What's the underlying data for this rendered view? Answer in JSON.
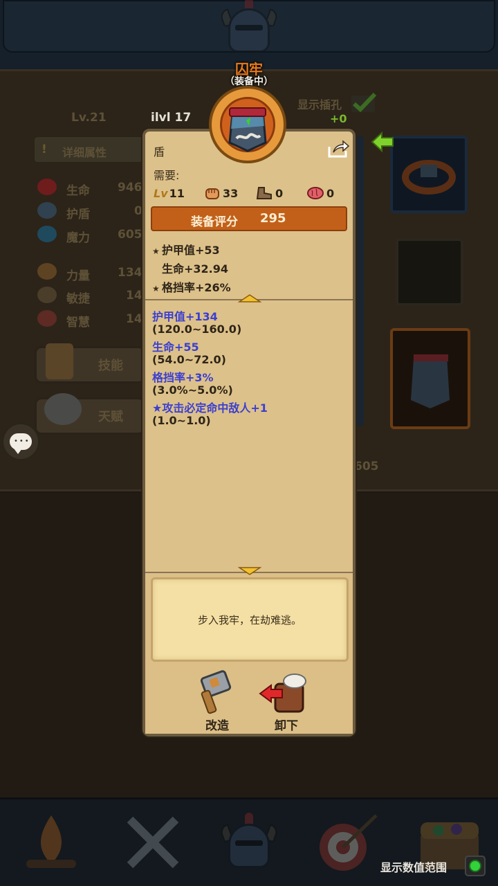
{
  "item": {
    "name": "囚牢",
    "status": "（装备中）",
    "ilvl_label": "ilvl",
    "ilvl_value": "17",
    "type": "盾"
  },
  "requirements": {
    "label": "需要:",
    "level_badge": "Lv",
    "level": "11",
    "strength": "33",
    "agility": "0",
    "wisdom": "0"
  },
  "score": {
    "label": "装备评分",
    "value": "295"
  },
  "base_stats": [
    {
      "text": "护甲值+53",
      "starred": true
    },
    {
      "text": "生命+32.94",
      "starred": false
    },
    {
      "text": "格挡率+26%",
      "starred": true
    }
  ],
  "affixes": [
    {
      "text": "护甲值+134",
      "range": "(120.0~160.0)",
      "starred": false
    },
    {
      "text": "生命+55",
      "range": "(54.0~72.0)",
      "starred": false
    },
    {
      "text": "格挡率+3%",
      "range": "(3.0%~5.0%)",
      "starred": false
    },
    {
      "text": "攻击必定命中敌人+1",
      "range": "(1.0~1.0)",
      "starred": true
    }
  ],
  "flavor": "步入我牢，在劫难逃。",
  "actions": {
    "reforge": "改造",
    "unequip": "卸下"
  },
  "background": {
    "level": "Lv.21",
    "detail_button": "详细属性",
    "detail_mark": "!",
    "show_sockets": "显示插孔",
    "socket_bonus": "+0",
    "stats": [
      {
        "label": "生命",
        "value": "946"
      },
      {
        "label": "护盾",
        "value": "0"
      },
      {
        "label": "魔力",
        "value": "605"
      },
      {
        "label": "力量",
        "value": "134"
      },
      {
        "label": "敏捷",
        "value": "14"
      },
      {
        "label": "智慧",
        "value": "14"
      }
    ],
    "skill_button": "技能",
    "talent_button": "天赋",
    "bottom_value": "605"
  },
  "footer": {
    "show_range": "显示数值范围",
    "show_range_enabled": true
  },
  "colors": {
    "item_name": "#e87a1c",
    "affix_blue": "#3b3fd0",
    "score_bar": "#c2601a",
    "panel": "#ddc18a"
  }
}
